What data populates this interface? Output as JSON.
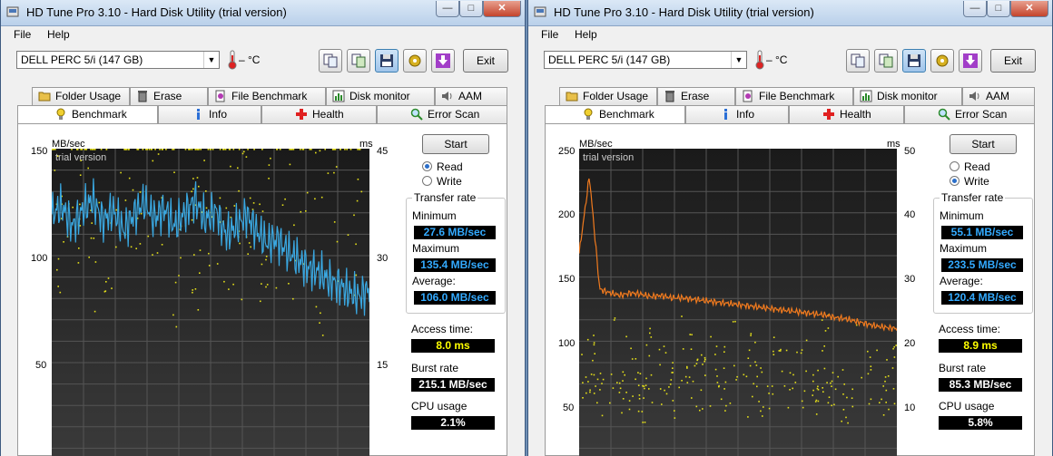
{
  "windows": [
    {
      "title": "HD Tune Pro 3.10 - Hard Disk Utility (trial version)",
      "menu": {
        "file": "File",
        "help": "Help"
      },
      "drive": "DELL    PERC 5/i (147 GB)",
      "temperature": "– °C",
      "exit_label": "Exit",
      "tabs_row1": [
        "Folder Usage",
        "Erase",
        "File Benchmark",
        "Disk monitor",
        "AAM"
      ],
      "tabs_row2": [
        "Benchmark",
        "Info",
        "Health",
        "Error Scan"
      ],
      "start_label": "Start",
      "mode_read": "Read",
      "mode_write": "Write",
      "selected_mode": "Read",
      "transfer_rate_title": "Transfer rate",
      "minimum_label": "Minimum",
      "minimum": "27.6 MB/sec",
      "maximum_label": "Maximum",
      "maximum": "135.4 MB/sec",
      "average_label": "Average:",
      "average": "106.0 MB/sec",
      "access_label": "Access time:",
      "access": "8.0 ms",
      "burst_label": "Burst rate",
      "burst": "215.1 MB/sec",
      "cpu_label": "CPU usage",
      "cpu": "2.1%",
      "unit_left": "MB/sec",
      "unit_right": "ms",
      "watermark": "trial version",
      "yticks_left": [
        "150",
        "100",
        "50"
      ],
      "yticks_right": [
        "45",
        "30",
        "15"
      ]
    },
    {
      "title": "HD Tune Pro 3.10 - Hard Disk Utility (trial version)",
      "menu": {
        "file": "File",
        "help": "Help"
      },
      "drive": "DELL    PERC 5/i (147 GB)",
      "temperature": "– °C",
      "exit_label": "Exit",
      "tabs_row1": [
        "Folder Usage",
        "Erase",
        "File Benchmark",
        "Disk monitor",
        "AAM"
      ],
      "tabs_row2": [
        "Benchmark",
        "Info",
        "Health",
        "Error Scan"
      ],
      "start_label": "Start",
      "mode_read": "Read",
      "mode_write": "Write",
      "selected_mode": "Write",
      "transfer_rate_title": "Transfer rate",
      "minimum_label": "Minimum",
      "minimum": "55.1 MB/sec",
      "maximum_label": "Maximum",
      "maximum": "233.5 MB/sec",
      "average_label": "Average:",
      "average": "120.4 MB/sec",
      "access_label": "Access time:",
      "access": "8.9 ms",
      "burst_label": "Burst rate",
      "burst": "85.3 MB/sec",
      "cpu_label": "CPU usage",
      "cpu": "5.8%",
      "unit_left": "MB/sec",
      "unit_right": "ms",
      "watermark": "trial version",
      "yticks_left": [
        "250",
        "200",
        "150",
        "100",
        "50"
      ],
      "yticks_right": [
        "50",
        "40",
        "30",
        "20",
        "10"
      ]
    }
  ],
  "colors": {
    "read_line": "#3aa7e0",
    "write_line": "#f07a1e",
    "access_dots": "#e5e01a",
    "value_blue": "#33aaff",
    "value_yellow": "#ffff00"
  },
  "chart_data": [
    {
      "type": "line",
      "series": [
        {
          "values": [
            118,
            122,
            112,
            120,
            125,
            115,
            120,
            110,
            118,
            124,
            116,
            121,
            112,
            119,
            125,
            115,
            120,
            108,
            112,
            118,
            110,
            104,
            106,
            100,
            96,
            92,
            90,
            86,
            84,
            80,
            78,
            82
          ]
        },
        {
          "values": [
            48,
            35,
            42,
            50,
            38,
            44,
            30,
            46,
            40,
            36,
            52,
            41,
            33,
            45,
            39,
            47,
            37,
            43,
            34,
            49,
            41,
            36,
            44,
            38,
            46,
            42,
            31,
            45,
            40,
            43,
            37,
            44
          ]
        }
      ],
      "ylim_left": [
        0,
        150
      ],
      "ylim_right": [
        0,
        45
      ]
    },
    {
      "type": "line",
      "series": [
        {
          "values": [
            165,
            228,
            136,
            133,
            131,
            133,
            132,
            130,
            131,
            129,
            129,
            128,
            127,
            126,
            125,
            124,
            123,
            122,
            121,
            120,
            119,
            118,
            117,
            116,
            115,
            113,
            112,
            110,
            108,
            106,
            105,
            104
          ]
        },
        {
          "values": [
            13,
            15,
            11,
            16,
            12,
            14,
            10,
            15,
            13,
            11,
            17,
            14,
            12,
            15,
            13,
            16,
            12,
            14,
            11,
            15,
            13,
            12,
            14,
            11,
            16,
            13,
            10,
            15,
            12,
            14,
            11,
            13
          ]
        }
      ],
      "ylim_left": [
        0,
        250
      ],
      "ylim_right": [
        0,
        50
      ]
    }
  ]
}
